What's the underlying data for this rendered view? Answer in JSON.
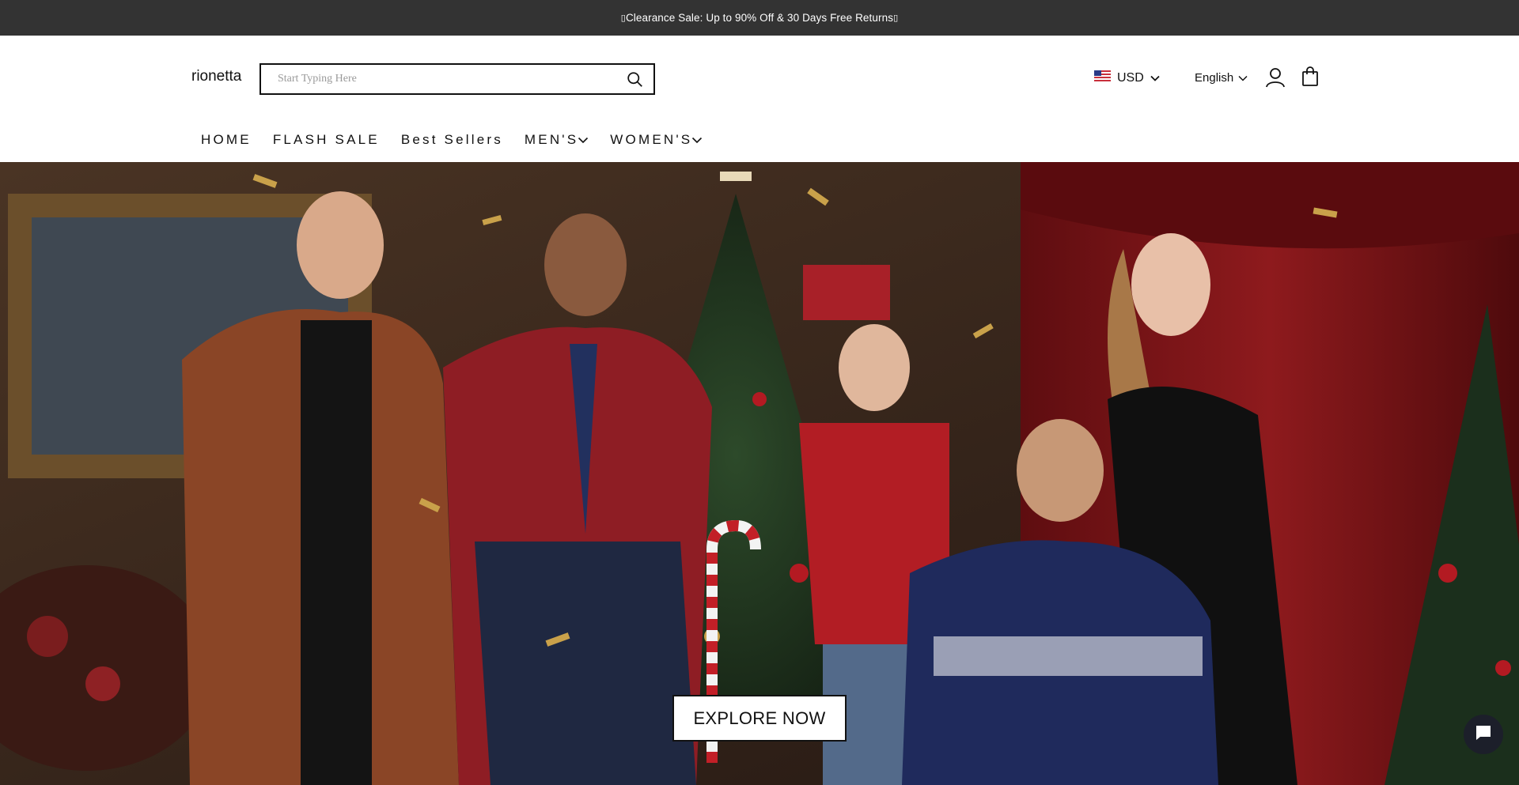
{
  "announcement": {
    "text": "Clearance Sale: Up to 90% Off & 30 Days Free Returns",
    "prefix_glyph": "▯",
    "suffix_glyph": "▯"
  },
  "header": {
    "logo": "rionetta",
    "search": {
      "placeholder": "Start Typing Here",
      "value": ""
    },
    "currency": {
      "flag_icon": "us-flag-icon",
      "label": "USD"
    },
    "language": {
      "label": "English"
    },
    "icons": [
      "search-icon",
      "account-icon",
      "shopping-bag-icon",
      "chevron-down-icon"
    ]
  },
  "nav": {
    "items": [
      {
        "label": "HOME",
        "has_dropdown": false
      },
      {
        "label": "FLASH SALE",
        "has_dropdown": false
      },
      {
        "label": "Best Sellers",
        "has_dropdown": false
      },
      {
        "label": "MEN'S",
        "has_dropdown": true
      },
      {
        "label": "WOMEN'S",
        "has_dropdown": true
      }
    ]
  },
  "hero": {
    "cta_label": "EXPLORE NOW"
  },
  "chat_widget": {
    "icon": "chat-bubble-icon"
  },
  "colors": {
    "announcement_bg": "#333333",
    "text": "#111111",
    "hero_red": "#7a1414",
    "chat_bg": "#1c1f2a"
  }
}
